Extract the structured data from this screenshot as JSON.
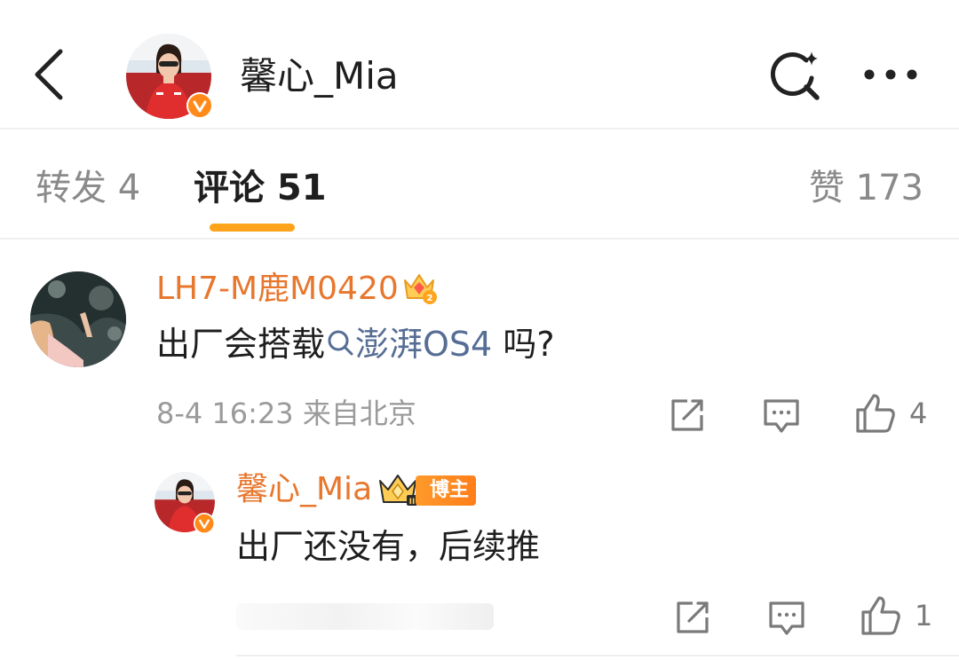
{
  "header": {
    "author_name": "馨心_Mia",
    "back_icon": "chevron-left-icon",
    "search_icon": "search-sparkle-icon",
    "more_icon": "more-horizontal-icon"
  },
  "tabs": {
    "repost": "转发 4",
    "comment": "评论 51",
    "like": "赞 173",
    "active": "comment",
    "active_color": "#ffa31a"
  },
  "comment": {
    "user_name": "LH7-M鹿M0420",
    "text_before": "出厂会搭载",
    "topic": "澎湃OS4",
    "text_after": " 吗?",
    "meta": "8-4 16:23 来自北京",
    "like_count": "4",
    "name_color": "#e8772e",
    "topic_color": "#566d94"
  },
  "reply": {
    "user_name": "馨心_Mia",
    "badge_label": "博主",
    "text": "出厂还没有，后续推",
    "like_count": "1",
    "badge_color": "#ff8a20"
  }
}
